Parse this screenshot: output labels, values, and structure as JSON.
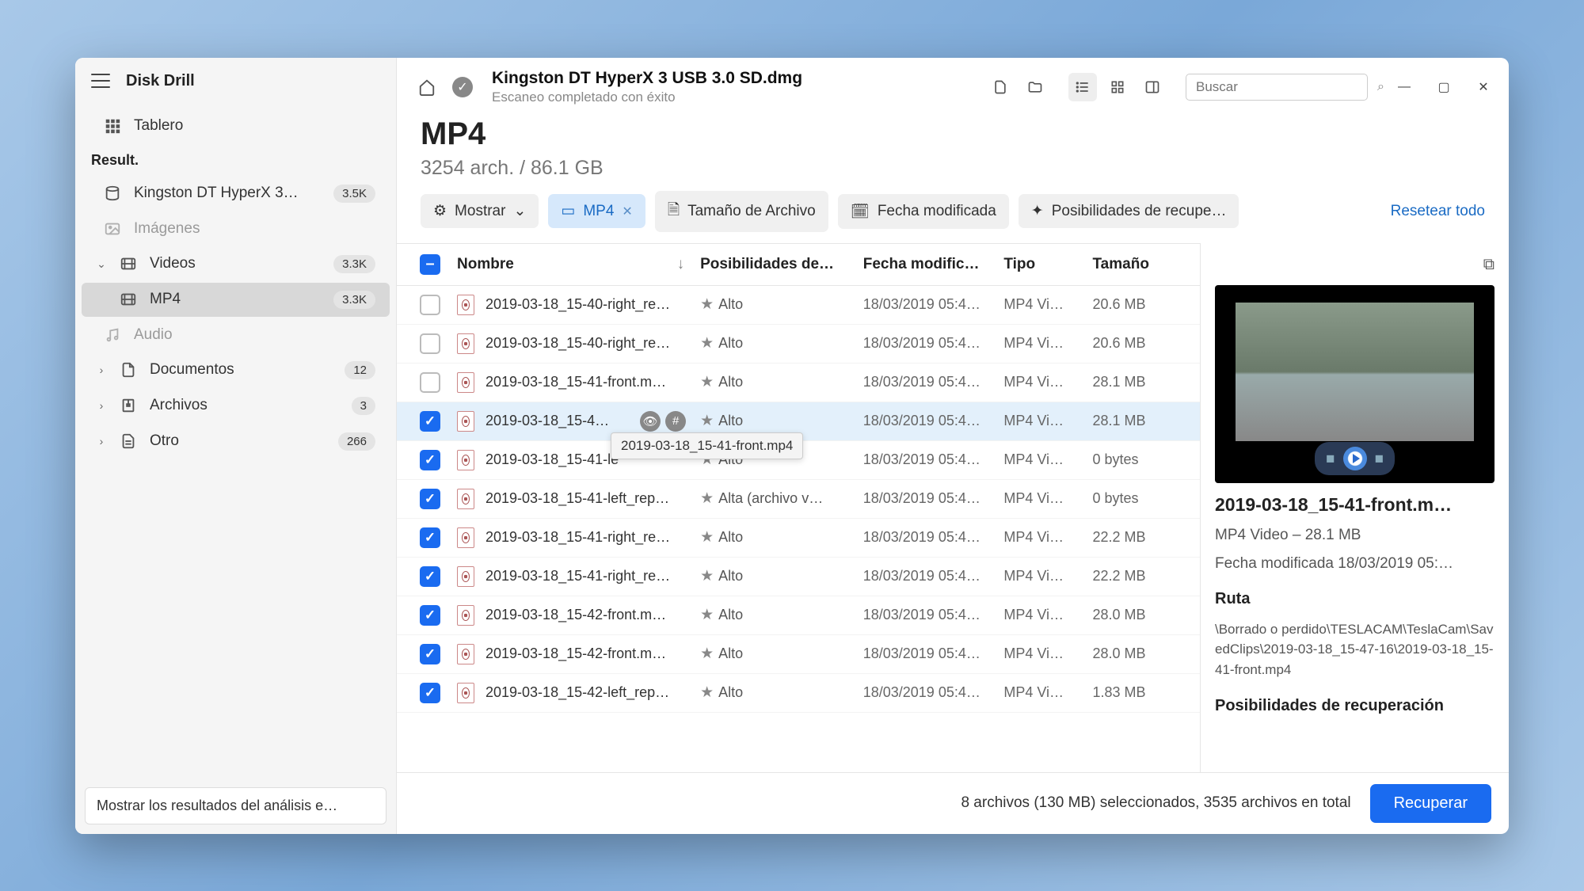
{
  "app": {
    "title": "Disk Drill"
  },
  "sidebar": {
    "dashboard_label": "Tablero",
    "result_label": "Result.",
    "disk": {
      "label": "Kingston DT HyperX 3…",
      "badge": "3.5K"
    },
    "images_label": "Imágenes",
    "videos": {
      "label": "Videos",
      "badge": "3.3K"
    },
    "mp4": {
      "label": "MP4",
      "badge": "3.3K"
    },
    "audio_label": "Audio",
    "documents": {
      "label": "Documentos",
      "badge": "12"
    },
    "archives": {
      "label": "Archivos",
      "badge": "3"
    },
    "other": {
      "label": "Otro",
      "badge": "266"
    },
    "footer_btn": "Mostrar los resultados del análisis e…"
  },
  "header": {
    "title": "Kingston DT HyperX 3 USB 3.0 SD.dmg",
    "subtitle": "Escaneo completado con éxito",
    "search_placeholder": "Buscar"
  },
  "page": {
    "title": "MP4",
    "subtitle": "3254 arch. / 86.1 GB"
  },
  "filters": {
    "show": "Mostrar",
    "mp4": "MP4",
    "filesize": "Tamaño de Archivo",
    "modified": "Fecha modificada",
    "recovery": "Posibilidades de recupe…",
    "reset": "Resetear todo"
  },
  "columns": {
    "name": "Nombre",
    "recov": "Posibilidades de…",
    "date": "Fecha modific…",
    "type": "Tipo",
    "size": "Tamaño"
  },
  "recov_labels": {
    "high": "Alto",
    "high_file": "Alta (archivo v…"
  },
  "type_label": "MP4 Vi…",
  "rows": [
    {
      "checked": false,
      "name": "2019-03-18_15-40-right_re…",
      "recov": "high",
      "date": "18/03/2019 05:4…",
      "size": "20.6 MB"
    },
    {
      "checked": false,
      "name": "2019-03-18_15-40-right_re…",
      "recov": "high",
      "date": "18/03/2019 05:4…",
      "size": "20.6 MB"
    },
    {
      "checked": false,
      "name": "2019-03-18_15-41-front.m…",
      "recov": "high",
      "date": "18/03/2019 05:4…",
      "size": "28.1 MB"
    },
    {
      "checked": true,
      "name": "2019-03-18_15-4…",
      "recov": "high",
      "date": "18/03/2019 05:4…",
      "size": "28.1 MB",
      "hovered": true,
      "tooltip": "2019-03-18_15-41-front.mp4"
    },
    {
      "checked": true,
      "name": "2019-03-18_15-41-le",
      "recov": "high",
      "date": "18/03/2019 05:4…",
      "size": "0 bytes"
    },
    {
      "checked": true,
      "name": "2019-03-18_15-41-left_rep…",
      "recov": "high_file",
      "date": "18/03/2019 05:4…",
      "size": "0 bytes"
    },
    {
      "checked": true,
      "name": "2019-03-18_15-41-right_re…",
      "recov": "high",
      "date": "18/03/2019 05:4…",
      "size": "22.2 MB"
    },
    {
      "checked": true,
      "name": "2019-03-18_15-41-right_re…",
      "recov": "high",
      "date": "18/03/2019 05:4…",
      "size": "22.2 MB"
    },
    {
      "checked": true,
      "name": "2019-03-18_15-42-front.m…",
      "recov": "high",
      "date": "18/03/2019 05:4…",
      "size": "28.0 MB"
    },
    {
      "checked": true,
      "name": "2019-03-18_15-42-front.m…",
      "recov": "high",
      "date": "18/03/2019 05:4…",
      "size": "28.0 MB"
    },
    {
      "checked": true,
      "name": "2019-03-18_15-42-left_rep…",
      "recov": "high",
      "date": "18/03/2019 05:4…",
      "size": "1.83 MB"
    }
  ],
  "preview": {
    "title": "2019-03-18_15-41-front.m…",
    "type_line": "MP4 Video – 28.1 MB",
    "date_line": "Fecha modificada 18/03/2019 05:…",
    "path_title": "Ruta",
    "path": "\\Borrado o perdido\\TESLACAM\\TeslaCam\\SavedClips\\2019-03-18_15-47-16\\2019-03-18_15-41-front.mp4",
    "recov_title": "Posibilidades de recuperación"
  },
  "status": {
    "text": "8 archivos (130 MB) seleccionados, 3535 archivos en total",
    "recover": "Recuperar"
  }
}
